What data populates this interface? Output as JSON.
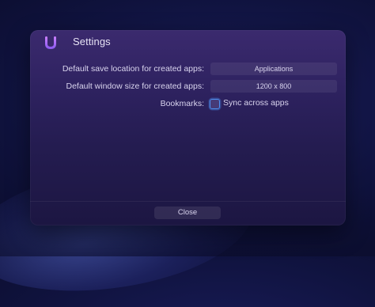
{
  "window": {
    "title": "Settings",
    "logo_icon": "brand-u-logo",
    "accent_color": "#b06cf0"
  },
  "settings": {
    "save_location": {
      "label": "Default save location for created apps:",
      "value": "Applications"
    },
    "window_size": {
      "label": "Default window size for created apps:",
      "value": "1200 x 800"
    },
    "bookmarks": {
      "label": "Bookmarks:",
      "checkbox_label": "Sync across apps",
      "checked": false
    }
  },
  "footer": {
    "close_label": "Close"
  }
}
